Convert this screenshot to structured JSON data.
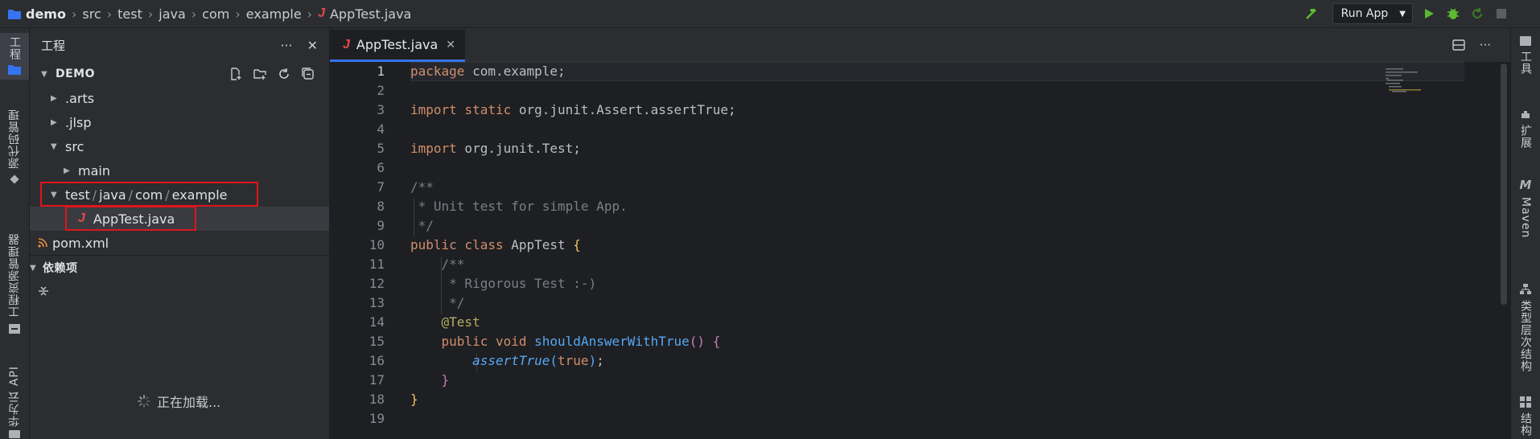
{
  "breadcrumb": {
    "project": "demo",
    "parts": [
      "src",
      "test",
      "java",
      "com",
      "example"
    ],
    "file": "AppTest.java"
  },
  "toolbar": {
    "run_config": "Run App"
  },
  "left_strip": {
    "project": "工程",
    "scm": "源代码管理",
    "explorer": "工程资源管理器",
    "cloud_api": "华为云 API"
  },
  "right_strip": {
    "tools": "工具",
    "extensions": "扩展",
    "maven": "Maven",
    "type_hierarchy": "类型层次结构",
    "structure": "结构"
  },
  "panel": {
    "title": "工程",
    "root": "DEMO",
    "items": {
      "arts": ".arts",
      "jlsp": ".jlsp",
      "src": "src",
      "main": "main",
      "test_parts": [
        "test",
        "java",
        "com",
        "example"
      ],
      "apptest": "AppTest.java",
      "pom": "pom.xml"
    },
    "deps": "依赖项",
    "loading": "正在加载..."
  },
  "editor": {
    "tab": "AppTest.java",
    "line_numbers": [
      "1",
      "2",
      "3",
      "4",
      "5",
      "6",
      "7",
      "8",
      "9",
      "10",
      "11",
      "12",
      "13",
      "14",
      "15",
      "16",
      "17",
      "18",
      "19"
    ]
  },
  "colors": {
    "accent": "#3574f0",
    "highlight_box": "#e0141c",
    "java_icon": "#e5484d",
    "run_green": "#5fb832"
  }
}
